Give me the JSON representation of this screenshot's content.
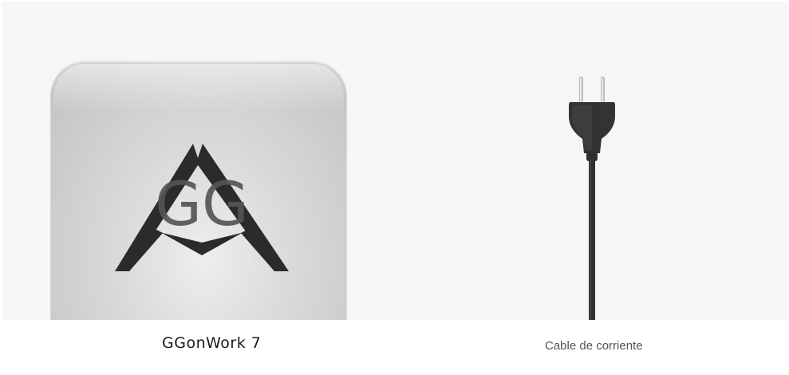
{
  "products": [
    {
      "name": "GGonWork 7",
      "logo_mark": "GG",
      "icon": "triangle-gg-logo-icon"
    },
    {
      "name": "Cable de corriente",
      "icon": "power-plug-icon"
    }
  ],
  "colors": {
    "stage_background": "#f6f6f6",
    "device_silver": "#d4d4d4",
    "logo_dark": "#2b2b2b",
    "logo_letters": "#555555",
    "cable_black": "#2f2f2f"
  }
}
